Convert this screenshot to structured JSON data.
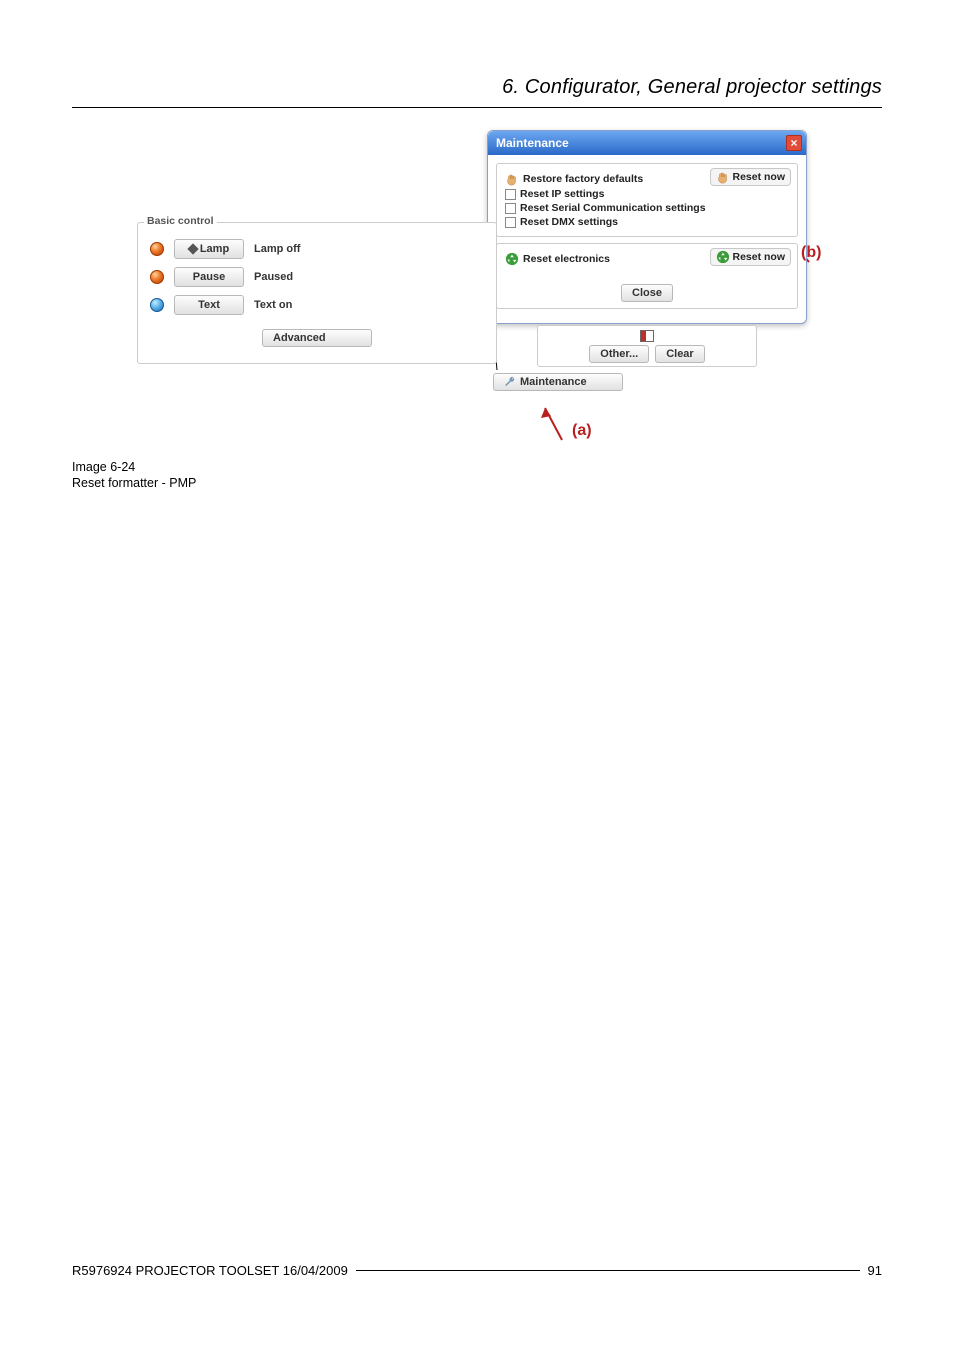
{
  "header": {
    "title": "6. Configurator, General projector settings"
  },
  "dialog": {
    "title": "Maintenance",
    "restore_factory": "Restore factory defaults",
    "reset_now_top": "Reset now",
    "opt_ip": "Reset IP settings",
    "opt_serial": "Reset Serial Communication settings",
    "opt_dmx": "Reset DMX settings",
    "reset_electronics": "Reset electronics",
    "reset_now_bottom": "Reset now",
    "close": "Close"
  },
  "basic": {
    "legend": "Basic control",
    "lamp_btn": "Lamp",
    "lamp_status": "Lamp off",
    "pause_btn": "Pause",
    "pause_status": "Paused",
    "text_btn": "Text",
    "text_status": "Text on",
    "advanced": "Advanced"
  },
  "strip": {
    "other": "Other...",
    "clear": "Clear",
    "maintenance": "Maintenance"
  },
  "annotations": {
    "a": "(a)",
    "b": "(b)"
  },
  "caption": {
    "line1": "Image 6-24",
    "line2": "Reset formatter - PMP"
  },
  "footer": {
    "text": "R5976924   PROJECTOR TOOLSET  16/04/2009",
    "page": "91"
  }
}
